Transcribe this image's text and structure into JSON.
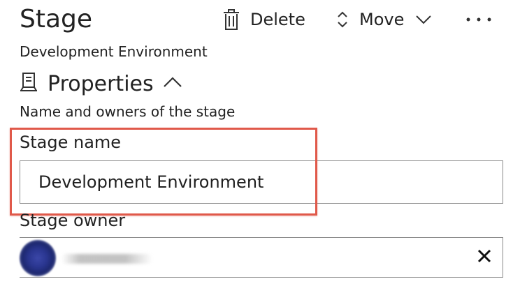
{
  "header": {
    "title": "Stage",
    "subtitle": "Development Environment",
    "commands": {
      "delete_label": "Delete",
      "move_label": "Move",
      "more_icon": "more-ellipsis-icon"
    }
  },
  "properties": {
    "heading": "Properties",
    "description": "Name and owners of the stage",
    "icon": "server-icon",
    "toggle_icon": "chevron-up-icon"
  },
  "form": {
    "stage_name": {
      "label": "Stage name",
      "value": "Development Environment"
    },
    "stage_owner": {
      "label": "Stage owner",
      "clear_icon": "close-icon"
    }
  },
  "colors": {
    "highlight": "#e0594a",
    "text": "#1f1f1f",
    "border": "#8a8a8a",
    "avatar": "#2a3690"
  }
}
